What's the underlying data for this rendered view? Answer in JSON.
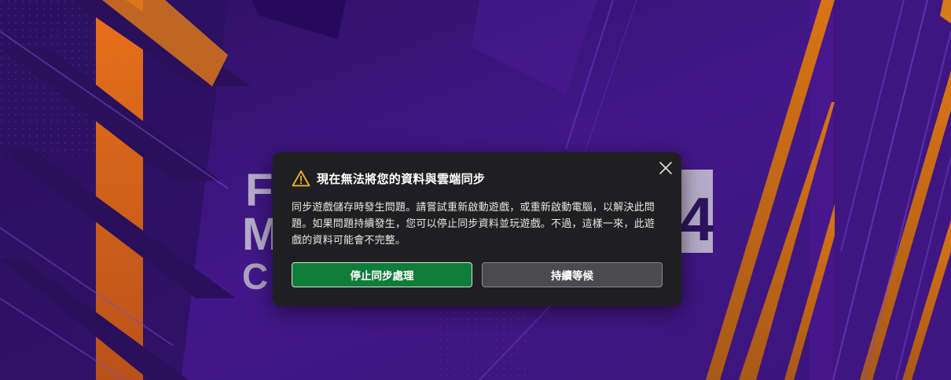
{
  "background": {
    "logo_text_lines": [
      "F",
      "M",
      "C"
    ],
    "logo_number": "4"
  },
  "dialog": {
    "title": "現在無法將您的資料與雲端同步",
    "warning_icon": "warning-triangle-icon",
    "close_icon": "close-icon",
    "body": "同步遊戲儲存時發生問題。請嘗試重新啟動遊戲，或重新啟動電腦，以解決此問題。如果問題持續發生，您可以停止同步資料並玩遊戲。不過，這樣一來，此遊戲的資料可能會不完整。",
    "primary_button": "停止同步處理",
    "secondary_button": "持續等候"
  },
  "colors": {
    "background_purple": "#3a1577",
    "accent_orange": "#e8701a",
    "dialog_bg": "#1f1f21",
    "primary_green": "#107c3a",
    "warning_yellow": "#f5b72a"
  }
}
